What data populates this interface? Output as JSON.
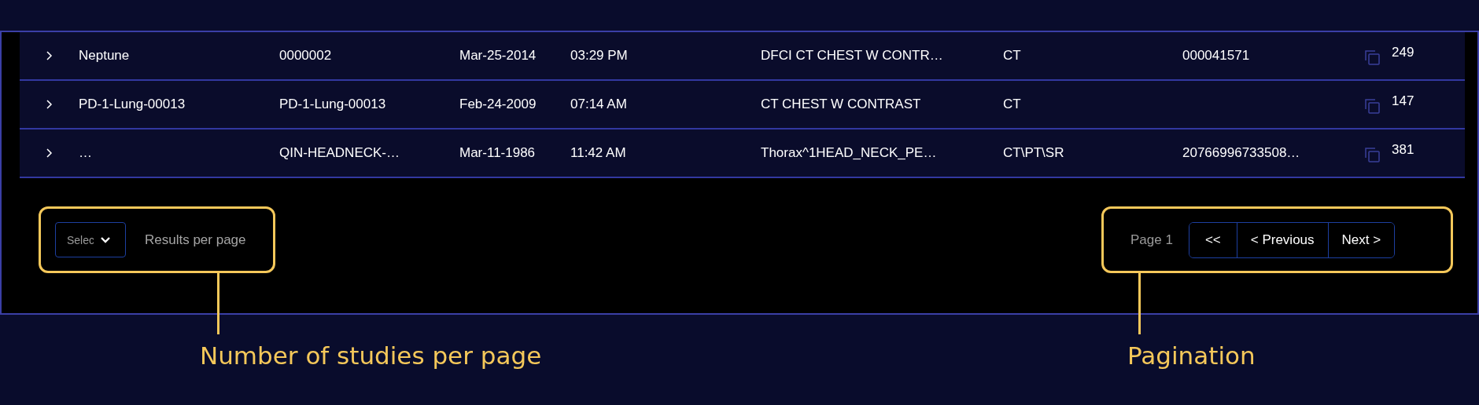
{
  "table": {
    "rows": [
      {
        "patient_name": "Neptune",
        "mrn": "0000002",
        "date": "Mar-25-2014",
        "time": "03:29 PM",
        "description": "DFCI CT CHEST W CONTR…",
        "modality": "CT",
        "accession": "000041571",
        "instances": "249"
      },
      {
        "patient_name": "PD-1-Lung-00013",
        "mrn": "PD-1-Lung-00013",
        "date": "Feb-24-2009",
        "time": "07:14 AM",
        "description": "CT CHEST W CONTRAST",
        "modality": "CT",
        "accession": "",
        "instances": "147"
      },
      {
        "patient_name": "…",
        "mrn": "QIN-HEADNECK-…",
        "date": "Mar-11-1986",
        "time": "11:42 AM",
        "description": "Thorax^1HEAD_NECK_PE…",
        "modality": "CT\\PT\\SR",
        "accession": "20766996733508…",
        "instances": "381"
      }
    ]
  },
  "results_per_page": {
    "placeholder": "Selec",
    "label": "Results per page"
  },
  "pagination": {
    "page_label": "Page 1",
    "buttons": [
      "<<",
      "< Previous",
      "Next >"
    ]
  },
  "annotations": [
    {
      "label": "Number of studies per page"
    },
    {
      "label": "Pagination"
    }
  ]
}
